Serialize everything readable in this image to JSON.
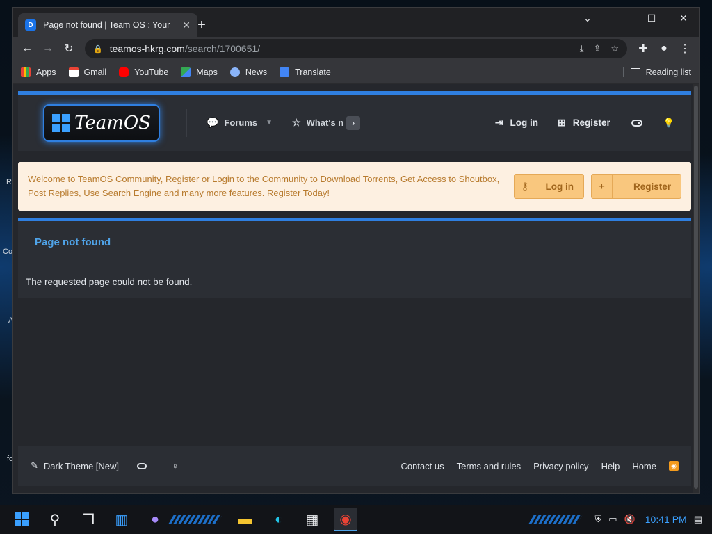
{
  "browser": {
    "tab_title": "Page not found | Team OS : Your",
    "url_host": "teamos-hkrg.com",
    "url_path": "/search/1700651/",
    "bookmarks": [
      "Apps",
      "Gmail",
      "YouTube",
      "Maps",
      "News",
      "Translate"
    ],
    "reading_list": "Reading list"
  },
  "header": {
    "logo_text": "TeamOS",
    "nav": [
      "Forums",
      "What's n"
    ],
    "login": "Log in",
    "register": "Register"
  },
  "notice": {
    "text": "Welcome to TeamOS Community, Register or Login to the Community to Download Torrents, Get Access to Shoutbox, Post Replies, Use Search Engine and many more features. Register Today!",
    "login": "Log in",
    "register": "Register"
  },
  "content": {
    "title": "Page not found",
    "message": "The requested page could not be found."
  },
  "footer": {
    "theme": "Dark Theme [New]",
    "links": [
      "Contact us",
      "Terms and rules",
      "Privacy policy",
      "Help",
      "Home"
    ]
  },
  "taskbar": {
    "clock": "10:41 PM"
  },
  "colors": {
    "accent": "#2f7fe0",
    "title_blue": "#4fa3e8",
    "notice_bg": "#fdf0e1",
    "notice_text": "#b87b2e",
    "button_orange": "#f9c77e"
  }
}
